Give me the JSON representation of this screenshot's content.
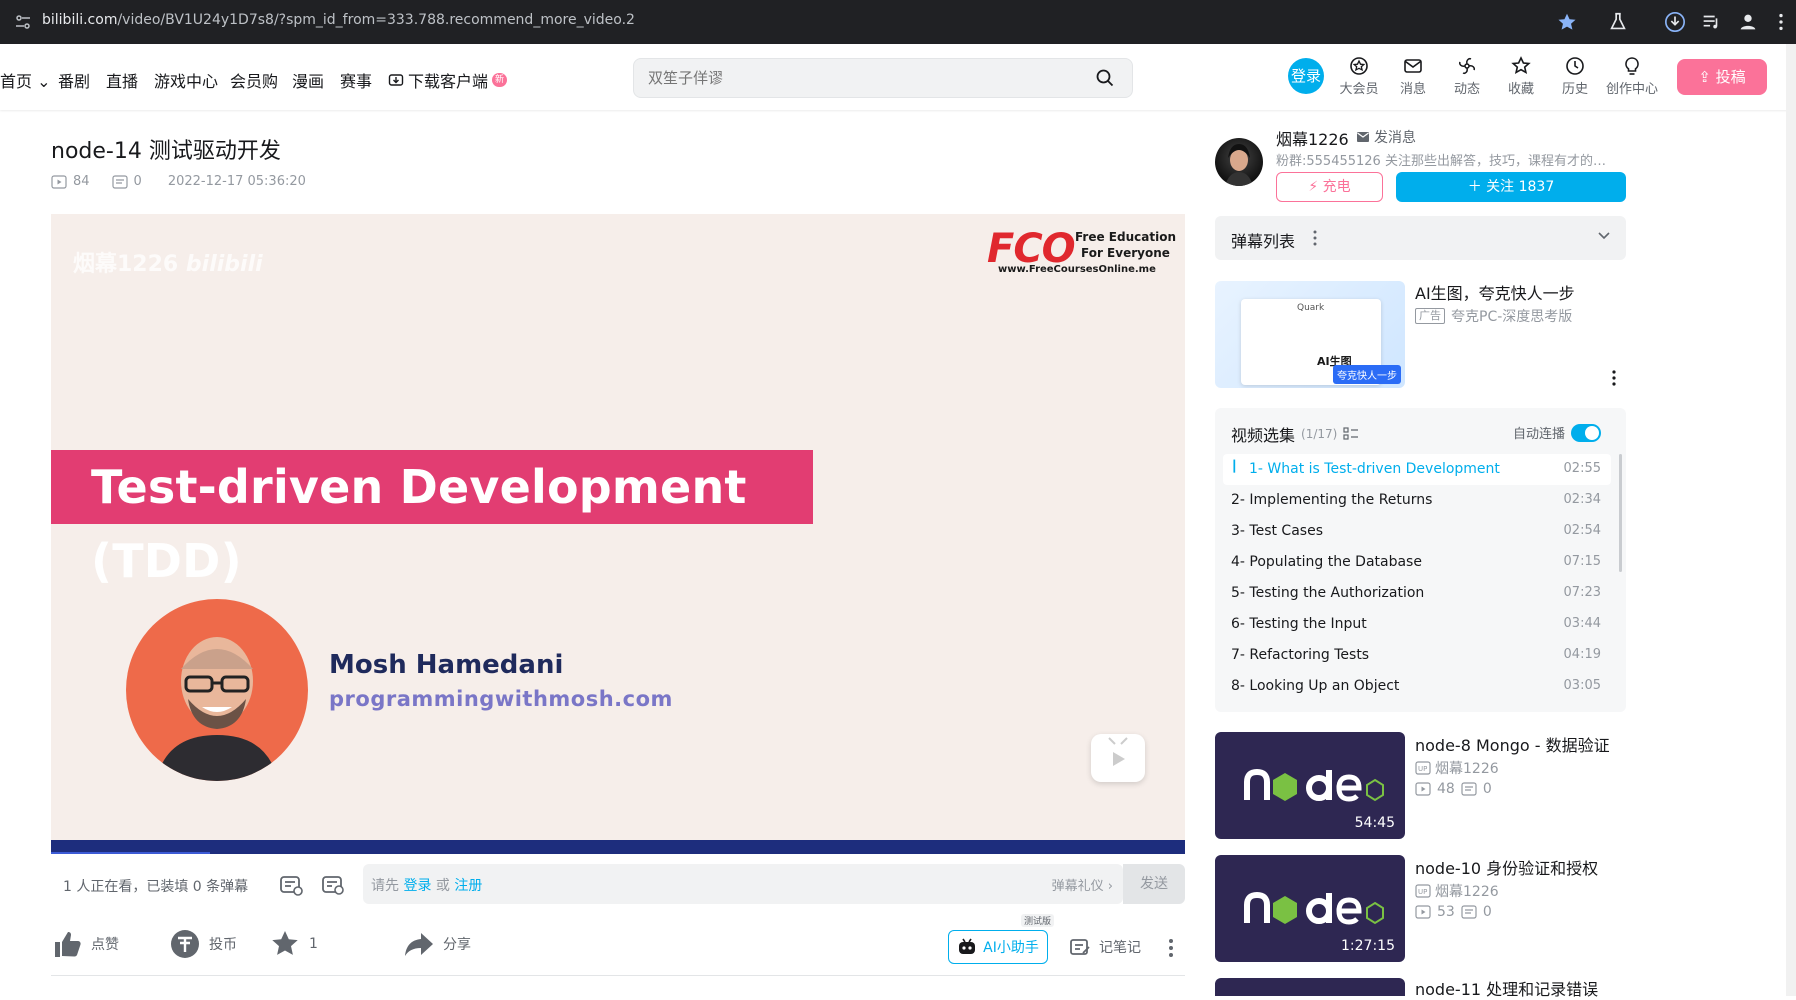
{
  "browser": {
    "url_domain": "bilibili.com",
    "url_path": "/video/BV1U24y1D7s8/?spm_id_from=333.788.recommend_more_video.2"
  },
  "header": {
    "nav": [
      "首页",
      "番剧",
      "直播",
      "游戏中心",
      "会员购",
      "漫画",
      "赛事",
      "下载客户端"
    ],
    "new_badge": "新",
    "search_placeholder": "双笙子佯谬",
    "login": "登录",
    "icons": [
      "大会员",
      "消息",
      "动态",
      "收藏",
      "历史",
      "创作中心"
    ],
    "upload": "投稿"
  },
  "video": {
    "title": "node-14 测试驱动开发",
    "views": "84",
    "danmaku_count": "0",
    "date": "2022-12-17 05:36:20",
    "watermark": "烟幕1226",
    "fco_main": "FCO",
    "fco_line1": "Free Education",
    "fco_line2": "For Everyone",
    "fco_site": "www.FreeCoursesOnline.me",
    "band_text": "Test-driven Development (TDD)",
    "presenter": "Mosh Hamedani",
    "presenter_site": "programmingwithmosh.com",
    "progress": 0.14
  },
  "danmaku_bar": {
    "status": "1 人正在看，已装填 0 条弹幕",
    "prompt_prefix": "请先",
    "login": "登录",
    "or": "或",
    "register": "注册",
    "etiquette": "弹幕礼仪 ›",
    "send": "发送"
  },
  "actions": {
    "like": "点赞",
    "coin": "投币",
    "fav": "1",
    "share": "分享",
    "ai": "AI小助手",
    "ai_badge": "测试版",
    "note": "记笔记"
  },
  "uploader": {
    "name": "烟幕1226",
    "message": "发消息",
    "desc": "粉群:555455126 关注那些出解答，技巧，课程有才的…",
    "charge": "充电",
    "follow": "关注 1837"
  },
  "danmaku_list": {
    "title": "弹幕列表"
  },
  "ad": {
    "title": "AI生图，夸克快人一步",
    "tag": "广告",
    "sub": "夸克PC-深度思考版",
    "thumb_caption": "夸克快人一步",
    "thumb_brand": "Quark",
    "thumb_big": "AI生图"
  },
  "playlist": {
    "title": "视频选集",
    "count": "(1/17)",
    "autoplay": "自动连播",
    "episodes": [
      {
        "name": "1- What is Test-driven Development",
        "dur": "02:55"
      },
      {
        "name": "2- Implementing the Returns",
        "dur": "02:34"
      },
      {
        "name": "3- Test Cases",
        "dur": "02:54"
      },
      {
        "name": "4- Populating the Database",
        "dur": "07:15"
      },
      {
        "name": "5- Testing the Authorization",
        "dur": "07:23"
      },
      {
        "name": "6- Testing the Input",
        "dur": "03:44"
      },
      {
        "name": "7- Refactoring Tests",
        "dur": "04:19"
      },
      {
        "name": "8- Looking Up an Object",
        "dur": "03:05"
      }
    ]
  },
  "recommendations": [
    {
      "title": "node-8 Mongo - 数据验证",
      "up": "烟幕1226",
      "views": "48",
      "danmaku": "0",
      "duration": "54:45"
    },
    {
      "title": "node-10 身份验证和授权",
      "up": "烟幕1226",
      "views": "53",
      "danmaku": "0",
      "duration": "1:27:15"
    },
    {
      "title": "node-11 处理和记录错误"
    }
  ],
  "colors": {
    "accent": "#00aeec",
    "pink": "#fb7299",
    "band": "#e23d72"
  }
}
